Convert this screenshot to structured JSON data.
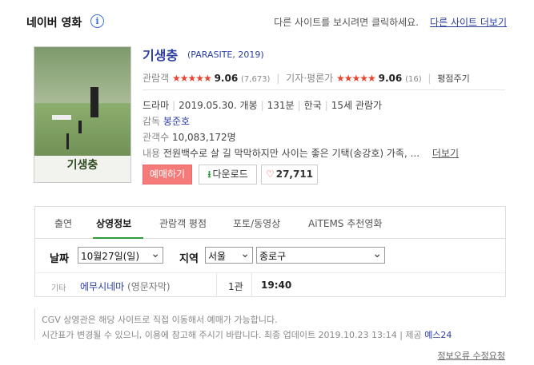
{
  "header": {
    "title": "네이버 영화",
    "info_icon": "i",
    "message": "다른 사이트를 보시려면 클릭하세요.",
    "link": "다른 사이트 더보기"
  },
  "poster": {
    "title": "기생충"
  },
  "movie": {
    "title": "기생충",
    "subtitle": "(PARASITE, 2019)",
    "audience": {
      "label": "관람객",
      "stars": "★★★★★",
      "score": "9.06",
      "count": "(7,673)"
    },
    "critic": {
      "label": "기자·평론가",
      "stars": "★★★★★",
      "score": "9.06",
      "count": "(16)"
    },
    "rate_more": "평점주기",
    "genre": "드라마",
    "release": "2019.05.30. 개봉",
    "runtime": "131분",
    "country": "한국",
    "rating": "15세 관람가",
    "director_label": "감독",
    "director": "봉준호",
    "viewers_label": "관객수",
    "viewers": "10,083,172명",
    "content_label": "내용",
    "content": "전원백수로 살 길 막막하지만 사이는 좋은 기택(송강호) 가족, ...",
    "more": "더보기"
  },
  "buttons": {
    "book": "예매하기",
    "download": "다운로드",
    "like_count": "27,711"
  },
  "tabs": [
    "출연",
    "상영정보",
    "관람객 평점",
    "포토/동영상",
    "AiTEMS 추천영화"
  ],
  "filters": {
    "date_label": "날짜",
    "date_value": "10월27일(일)",
    "region_label": "지역",
    "region_value": "서울",
    "district_value": "종로구"
  },
  "schedule": [
    {
      "category": "기타",
      "theater": "에무시네마",
      "note": "(영문자막)",
      "screen": "1관",
      "time": "19:40"
    }
  ],
  "notes": {
    "line1": "CGV 상영관은 해당 사이트로 직접 이동해서 예매가 가능합니다.",
    "line2": "시간표가 변경될 수 있으니, 이용에 참고해 주시기 바랍니다. 최종 업데이트 2019.10.23 13:14 | 제공",
    "provider": "예스24"
  },
  "report": "정보오류 수정요청",
  "colors": {
    "accent_blue": "#2b3fa3",
    "star_red": "#e8442e",
    "book_pink": "#f47b79",
    "tab_green": "#2e9c3a"
  }
}
